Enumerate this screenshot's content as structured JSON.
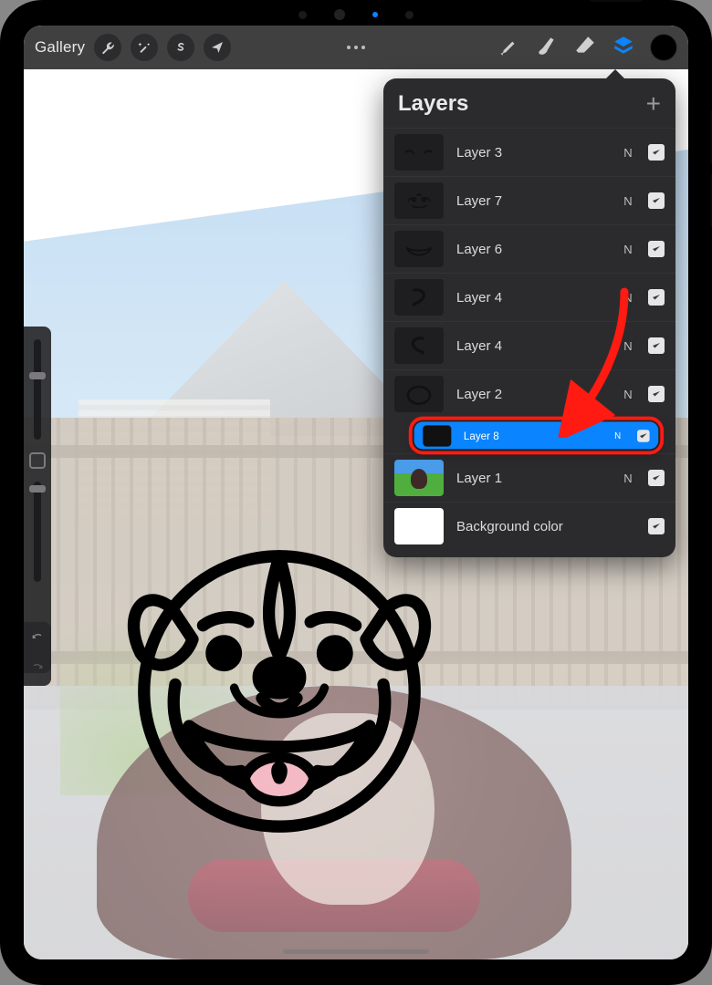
{
  "topbar": {
    "gallery_label": "Gallery"
  },
  "layers_panel": {
    "title": "Layers",
    "blend_normal": "N",
    "layers": [
      {
        "name": "Layer 3"
      },
      {
        "name": "Layer 7"
      },
      {
        "name": "Layer 6"
      },
      {
        "name": "Layer 4"
      },
      {
        "name": "Layer 4"
      },
      {
        "name": "Layer 2"
      },
      {
        "name": "Layer 8"
      },
      {
        "name": "Layer 1"
      },
      {
        "name": "Background color"
      }
    ]
  },
  "colors": {
    "accent": "#0a84ff",
    "annotation": "#ff1a12"
  }
}
